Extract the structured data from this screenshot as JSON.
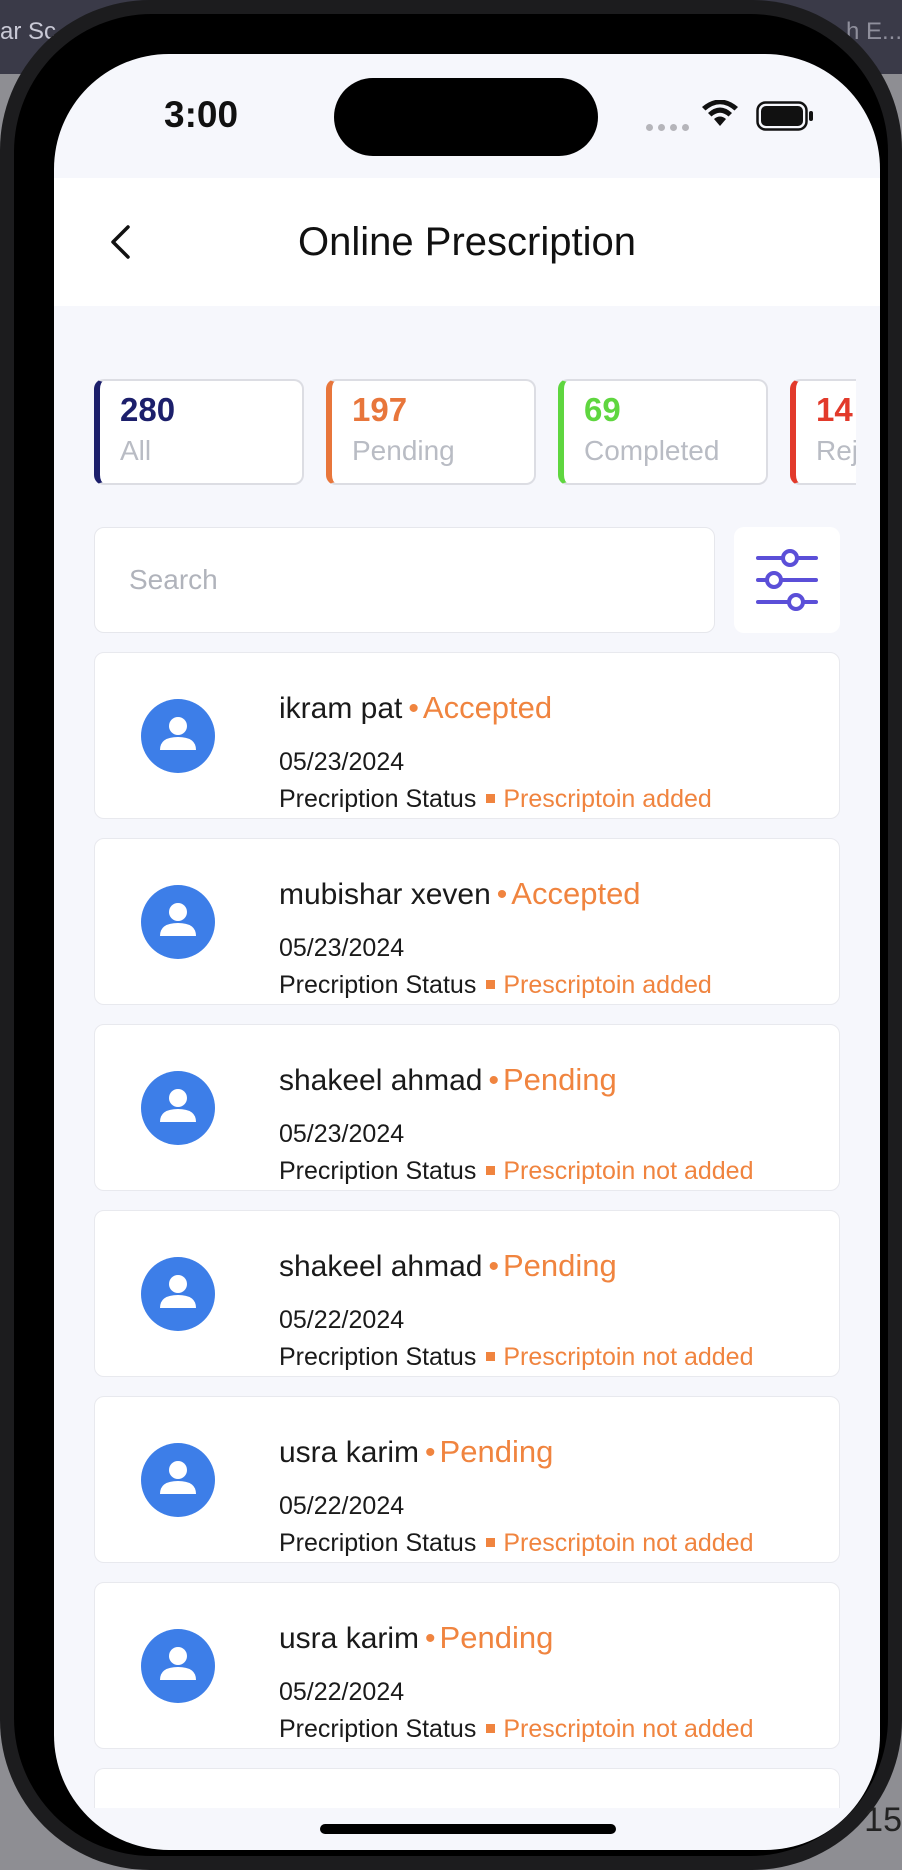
{
  "background": {
    "left_text": "ar Sc",
    "right_text": "h E...",
    "corner_text": "15"
  },
  "status_bar": {
    "time": "3:00"
  },
  "header": {
    "title": "Online Prescription"
  },
  "stats": [
    {
      "value": "280",
      "label": "All",
      "color": "#1c1f6b"
    },
    {
      "value": "197",
      "label": "Pending",
      "color": "#e8763b"
    },
    {
      "value": "69",
      "label": "Completed",
      "color": "#5fd63f"
    },
    {
      "value": "14",
      "label": "Rejected",
      "color": "#e23a2b"
    }
  ],
  "search": {
    "placeholder": "Search"
  },
  "colors": {
    "accent_orange": "#f0843f",
    "avatar_blue": "#3d7ee8",
    "filter_icon": "#5b4fd8"
  },
  "prescriptions": [
    {
      "name": "ikram pat",
      "status": "Accepted",
      "date": "05/23/2024",
      "status_label": "Precription Status",
      "prescription_status": "Prescriptoin added"
    },
    {
      "name": "mubishar xeven",
      "status": "Accepted",
      "date": "05/23/2024",
      "status_label": "Precription Status",
      "prescription_status": "Prescriptoin added"
    },
    {
      "name": "shakeel ahmad",
      "status": "Pending",
      "date": "05/23/2024",
      "status_label": "Precription Status",
      "prescription_status": "Prescriptoin not added"
    },
    {
      "name": "shakeel ahmad",
      "status": "Pending",
      "date": "05/22/2024",
      "status_label": "Precription Status",
      "prescription_status": "Prescriptoin not added"
    },
    {
      "name": "usra karim",
      "status": "Pending",
      "date": "05/22/2024",
      "status_label": "Precription Status",
      "prescription_status": "Prescriptoin not added"
    },
    {
      "name": "usra karim",
      "status": "Pending",
      "date": "05/22/2024",
      "status_label": "Precription Status",
      "prescription_status": "Prescriptoin not added"
    }
  ]
}
